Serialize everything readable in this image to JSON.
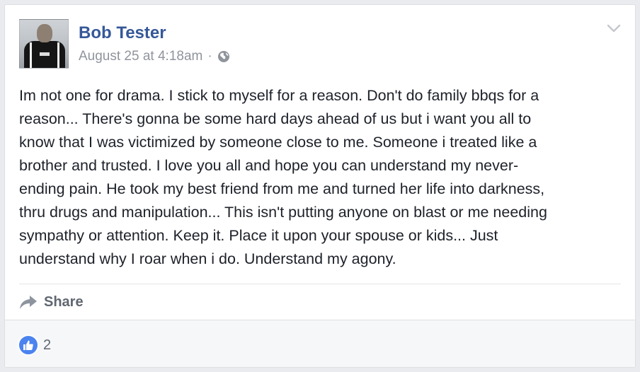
{
  "post": {
    "author": "Bob Tester",
    "timestamp": "August 25 at 4:18am",
    "separator": "·",
    "privacy_icon": "globe-icon",
    "options_icon": "chevron-down-icon",
    "text": "Im not one for drama. I stick to myself for a reason. Don't do family bbqs for a\nreason... There's gonna be some hard days ahead of us but i want you all to\nknow that I was victimized by someone close to me. Someone i treated like a\nbrother and trusted. I love you all and hope you can understand my never-\nending pain. He took my best friend from me and turned her life into darkness,\nthru drugs and manipulation... This isn't putting anyone on blast or me needing\nsympathy or attention. Keep it. Place it upon your spouse or kids... Just\nunderstand why I roar when i do. Understand my agony."
  },
  "actions": {
    "share_label": "Share",
    "share_icon": "share-arrow-icon"
  },
  "reactions": {
    "icon": "like-icon",
    "count": "2",
    "color": "#4b83ef"
  },
  "colors": {
    "name": "#365899",
    "meta": "#90949c",
    "text": "#1d2129",
    "background": "#e9ebee"
  }
}
